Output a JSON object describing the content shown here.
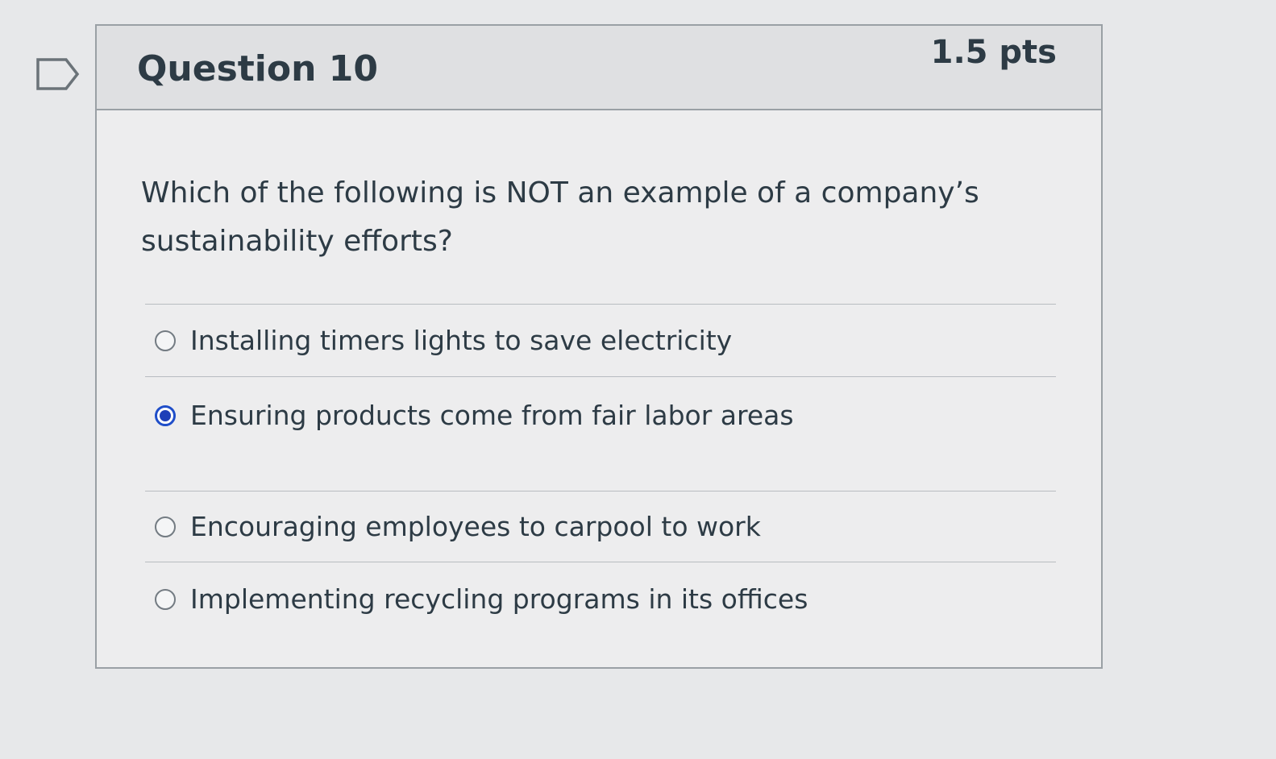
{
  "question": {
    "title": "Question 10",
    "points": "1.5 pts",
    "text": "Which of the following is NOT an example of a company’s sustainability efforts?"
  },
  "answers": [
    {
      "label": "Installing timers lights to save electricity",
      "selected": false
    },
    {
      "label": "Ensuring products come from fair labor areas",
      "selected": true
    },
    {
      "label": "Encouraging employees to carpool to work",
      "selected": false
    },
    {
      "label": "Implementing recycling programs in its offices",
      "selected": false
    }
  ],
  "colors": {
    "selected_radio": "#1e3fb8",
    "text": "#2d3b45",
    "header_bg": "#dfe0e2"
  }
}
